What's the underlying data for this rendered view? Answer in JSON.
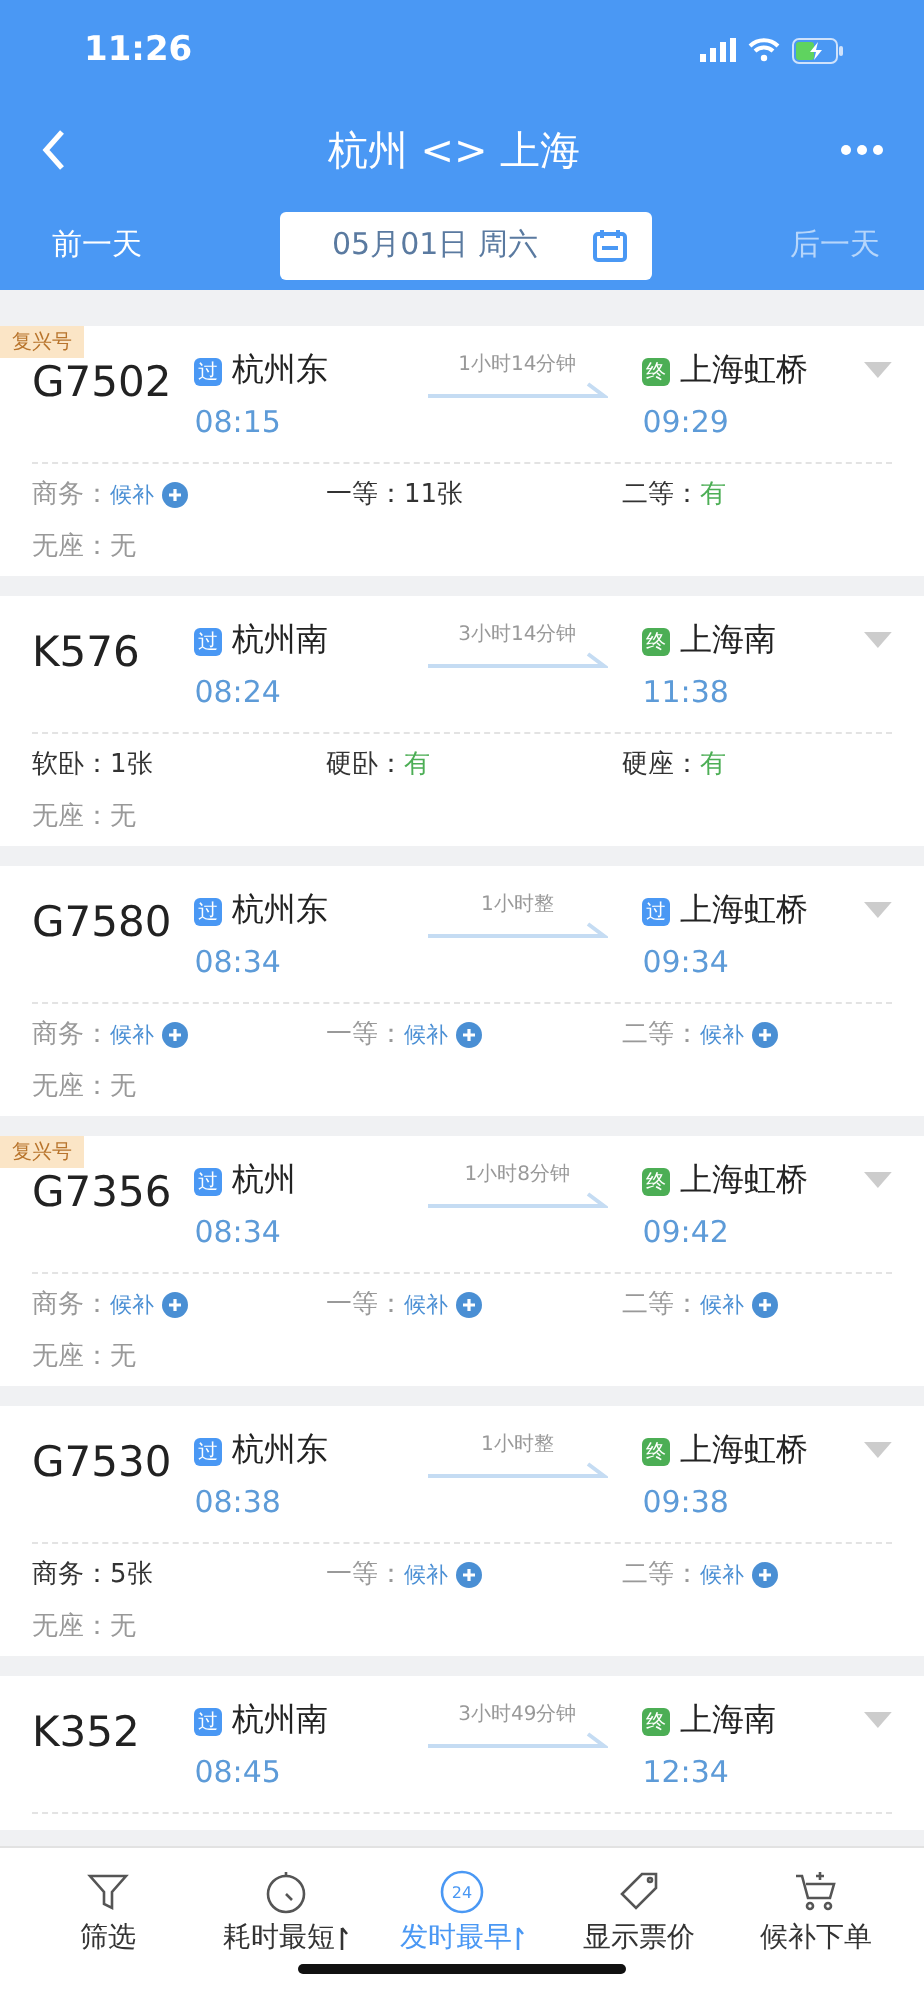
{
  "status_bar": {
    "time": "11:26"
  },
  "nav": {
    "title": "杭州 <> 上海"
  },
  "date_bar": {
    "prev": {
      "label": "前一天",
      "disabled": false
    },
    "date": "05月01日 周六",
    "next": {
      "label": "后一天",
      "disabled": true
    }
  },
  "trains": [
    {
      "badge": "复兴号",
      "number": "G7502",
      "from": {
        "mark": "过",
        "kind": "pass",
        "name": "杭州东",
        "time": "08:15"
      },
      "duration": "1小时14分钟",
      "to": {
        "mark": "终",
        "kind": "end",
        "name": "上海虹桥",
        "time": "09:29"
      },
      "seats": [
        {
          "label": "商务：",
          "value": "候补",
          "kind": "waitlist"
        },
        {
          "label": "一等：",
          "value": "11张",
          "kind": "count"
        },
        {
          "label": "二等：",
          "value": "有",
          "kind": "available"
        },
        {
          "label": "无座：",
          "value": "无",
          "kind": "none"
        }
      ]
    },
    {
      "number": "K576",
      "from": {
        "mark": "过",
        "kind": "pass",
        "name": "杭州南",
        "time": "08:24"
      },
      "duration": "3小时14分钟",
      "to": {
        "mark": "终",
        "kind": "end",
        "name": "上海南",
        "time": "11:38"
      },
      "seats": [
        {
          "label": "软卧：",
          "value": "1张",
          "kind": "count"
        },
        {
          "label": "硬卧：",
          "value": "有",
          "kind": "available"
        },
        {
          "label": "硬座：",
          "value": "有",
          "kind": "available"
        },
        {
          "label": "无座：",
          "value": "无",
          "kind": "none"
        }
      ]
    },
    {
      "number": "G7580",
      "from": {
        "mark": "过",
        "kind": "pass",
        "name": "杭州东",
        "time": "08:34"
      },
      "duration": "1小时整",
      "to": {
        "mark": "过",
        "kind": "pass",
        "name": "上海虹桥",
        "time": "09:34"
      },
      "seats": [
        {
          "label": "商务：",
          "value": "候补",
          "kind": "waitlist"
        },
        {
          "label": "一等：",
          "value": "候补",
          "kind": "waitlist"
        },
        {
          "label": "二等：",
          "value": "候补",
          "kind": "waitlist"
        },
        {
          "label": "无座：",
          "value": "无",
          "kind": "none"
        }
      ]
    },
    {
      "badge": "复兴号",
      "number": "G7356",
      "from": {
        "mark": "过",
        "kind": "pass",
        "name": "杭州",
        "time": "08:34"
      },
      "duration": "1小时8分钟",
      "to": {
        "mark": "终",
        "kind": "end",
        "name": "上海虹桥",
        "time": "09:42"
      },
      "seats": [
        {
          "label": "商务：",
          "value": "候补",
          "kind": "waitlist"
        },
        {
          "label": "一等：",
          "value": "候补",
          "kind": "waitlist"
        },
        {
          "label": "二等：",
          "value": "候补",
          "kind": "waitlist"
        },
        {
          "label": "无座：",
          "value": "无",
          "kind": "none"
        }
      ]
    },
    {
      "number": "G7530",
      "from": {
        "mark": "过",
        "kind": "pass",
        "name": "杭州东",
        "time": "08:38"
      },
      "duration": "1小时整",
      "to": {
        "mark": "终",
        "kind": "end",
        "name": "上海虹桥",
        "time": "09:38"
      },
      "seats": [
        {
          "label": "商务：",
          "value": "5张",
          "kind": "count"
        },
        {
          "label": "一等：",
          "value": "候补",
          "kind": "waitlist"
        },
        {
          "label": "二等：",
          "value": "候补",
          "kind": "waitlist"
        },
        {
          "label": "无座：",
          "value": "无",
          "kind": "none"
        }
      ]
    },
    {
      "number": "K352",
      "from": {
        "mark": "过",
        "kind": "pass",
        "name": "杭州南",
        "time": "08:45"
      },
      "duration": "3小时49分钟",
      "to": {
        "mark": "终",
        "kind": "end",
        "name": "上海南",
        "time": "12:34"
      }
    }
  ],
  "tabs": [
    {
      "label": "筛选",
      "kind": "filter",
      "sortable": false,
      "selected": false
    },
    {
      "label": "耗时最短",
      "kind": "timer",
      "sortable": true,
      "selected": false
    },
    {
      "label": "发时最早",
      "kind": "clock24",
      "icon_text": "24",
      "sortable": true,
      "selected": true
    },
    {
      "label": "显示票价",
      "kind": "tag",
      "sortable": false,
      "selected": false
    },
    {
      "label": "候补下单",
      "kind": "cart",
      "sortable": false,
      "selected": false
    }
  ]
}
